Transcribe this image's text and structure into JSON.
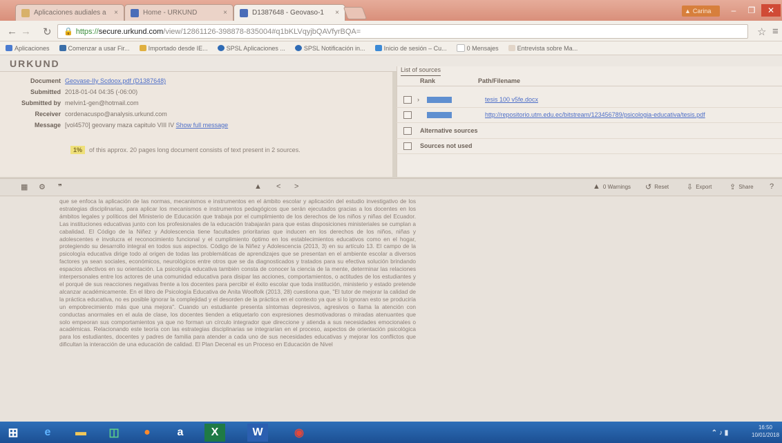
{
  "browser": {
    "tabs": [
      {
        "label": "Aplicaciones audiales a",
        "close": "×",
        "active": false
      },
      {
        "label": "Home - URKUND",
        "close": "×",
        "active": false
      },
      {
        "label": "D1387648 - Geovaso-1",
        "close": "×",
        "active": true
      }
    ],
    "user_badge": "Carina",
    "window_controls": {
      "minimize": "–",
      "maximize": "❐",
      "close": "✕"
    },
    "url_scheme": "https://",
    "url_domain": "secure.urkund.com",
    "url_path": "/view/12861126-398878-835004#q1bKLVqyjbQAVfyrBQA=",
    "bookmarks": [
      {
        "label": "Aplicaciones",
        "color": "#4a7bd0"
      },
      {
        "label": "Comenzar a usar Fir...",
        "color": "#3a6ea8"
      },
      {
        "label": "Importado desde IE...",
        "color": "#e0b040"
      },
      {
        "label": "SPSL Aplicaciones ...",
        "color": "#2f6bb5"
      },
      {
        "label": "SPSL Notificación in...",
        "color": "#2f6bb5"
      },
      {
        "label": "Inicio de sesión – Cu...",
        "color": "#3c8ad6"
      },
      {
        "label": "0 Mensajes",
        "color": "#ffffff"
      },
      {
        "label": "Entrevista sobre Ma...",
        "color": "#e2d5c8"
      }
    ]
  },
  "urkund": {
    "logo": "URKUND",
    "meta": [
      {
        "label": "Document",
        "value": "Geovase-IIy Scdoox.pdf (D1387648)",
        "link": true
      },
      {
        "label": "Submitted",
        "value": "2018-01-04 04:35 (-06:00)",
        "link": false
      },
      {
        "label": "Submitted by",
        "value": "melvin1-gen@hotmail.com",
        "link": false
      },
      {
        "label": "Receiver",
        "value": "cordenacuspo@analysis.urkund.com",
        "link": false
      },
      {
        "label": "Message",
        "value": "[vol4570] geovany maza capitulo VIII IV",
        "link": false
      }
    ],
    "message_link": "Show full message",
    "score_pct": "1%",
    "score_text": "of this approx. 20 pages long document consists of text present in 2 sources.",
    "sources_tab": "List of sources",
    "sources_headers": {
      "rank": "Rank",
      "path": "Path/Filename"
    },
    "sources": [
      {
        "arrow": "›",
        "path": "tesis 100 v5fe.docx",
        "rank_color": "#5f8fd0"
      },
      {
        "arrow": "",
        "path": "http://repositorio.utm.edu.ec/bitstream/123456789/psicologia-educativa/tesis.pdf",
        "rank_color": "#5f8fd0"
      }
    ],
    "source_groups": [
      "Alternative sources",
      "Sources not used"
    ],
    "toolbar": {
      "nav_up": "▲",
      "nav_prev": "<",
      "nav_next": ">",
      "warnings": "0 Warnings",
      "reset": "Reset",
      "export": "Export",
      "share": "Share",
      "help": "?"
    }
  },
  "document_text": "que se enfoca la aplicación de las normas, mecanismos e instrumentos en el ámbito escolar y aplicación del estudio investigativo de los estrategias disciplinarias, para aplicar los mecanismos e instrumentos pedagógicos que serán ejecutados gracias a los docentes en los ámbitos legales y políticos del Ministerio de Educación que trabaja por el cumplimiento de los derechos de los niños y niñas del Ecuador. Las instituciones educativas junto con los profesionales de la educación trabajarán para que estas disposiciones ministeriales se cumplan a cabalidad. El Código de la Niñez y Adolescencia tiene facultades prioritarias que inducen en los derechos de los niños, niñas y adolescentes e involucra el reconocimiento funcional y el cumplimiento óptimo en los establecimientos educativos como en el hogar, protegiendo su desarrollo integral en todos sus aspectos. Código de la Niñez y Adolescencia (2013, 3) en su artículo 13. El campo de la psicología educativa dirige todo al origen de todas las problemáticas de aprendizajes que se presentan en el ambiente escolar a diversos factores ya sean sociales, económicos, neurológicos entre otros que se da diagnosticados y tratados para su efectiva solución brindando espacios afectivos en su orientación. La psicología educativa también consta de conocer la ciencia de la mente, determinar las relaciones interpersonales entre los actores de una comunidad educativa para disipar las acciones, comportamientos, o actitudes de los estudiantes y el porqué de sus reacciones negativas frente a los docentes para percibir el éxito escolar que toda institución, ministerio y estado pretende alcanzar académicamente. En el libro de Psicología Educativa de Anita Woolfolk (2013, 28) cuestiona que, \"El tutor de mejorar la calidad de la práctica educativa, no es posible ignorar la complejidad y el desorden de la práctica en el contexto ya que si lo ignoran esto se produciría un empobrecimiento más que una mejora\". Cuando un estudiante presenta síntomas depresivos, agresivos o llama la atención con conductas anormales en el aula de clase, los docentes tienden a etiquetarlo con expresiones desmotivadoras o miradas atenuantes que solo empeoran sus comportamientos ya que no forman un círculo integrador que direccione y atienda a sus necesidades emocionales o académicas. Relacionando este teoría con las estrategias disciplinarias se integrarían en el proceso, aspectos de orientación psicológica para los estudiantes, docentes y padres de familia para atender a cada uno de sus necesidades educativas y mejorar los conflictos que dificultan la interacción de una educación de calidad. El Plan Decenal es un Proceso en Educación de Nivel",
  "taskbar": {
    "clock_time": "16:50",
    "clock_date": "10/01/2018"
  }
}
